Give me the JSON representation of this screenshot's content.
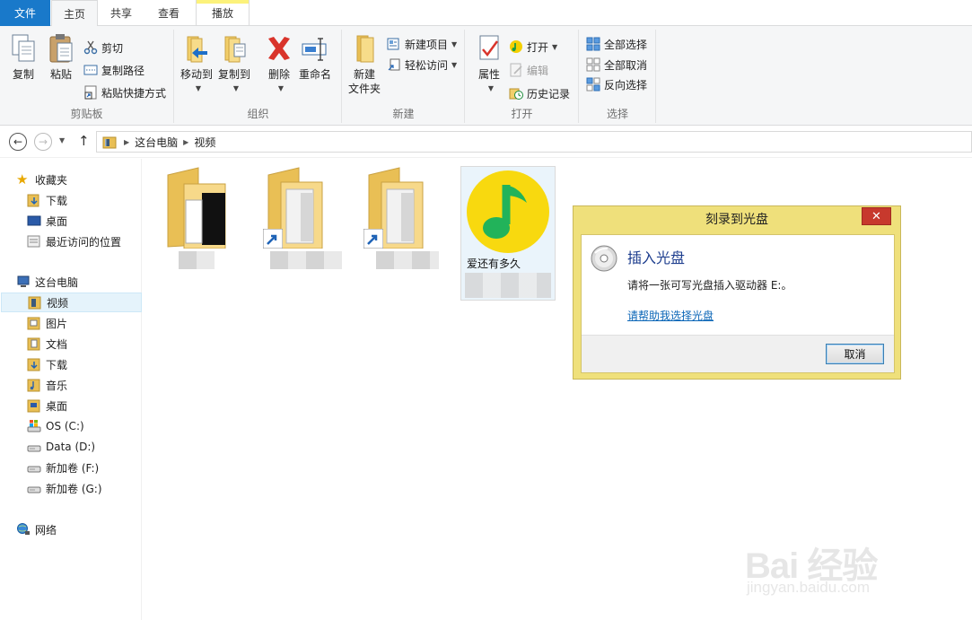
{
  "tabs": {
    "file": "文件",
    "home": "主页",
    "share": "共享",
    "view": "查看",
    "play": "播放"
  },
  "ribbon": {
    "clipboard": {
      "label": "剪贴板",
      "copy": "复制",
      "paste": "粘贴",
      "cut": "剪切",
      "copy_path": "复制路径",
      "paste_shortcut": "粘贴快捷方式"
    },
    "organize": {
      "label": "组织",
      "move_to": "移动到",
      "copy_to": "复制到",
      "delete": "删除",
      "rename": "重命名"
    },
    "new": {
      "label": "新建",
      "new_folder_line1": "新建",
      "new_folder_line2": "文件夹",
      "new_item": "新建项目",
      "easy_access": "轻松访问"
    },
    "open": {
      "label": "打开",
      "properties": "属性",
      "open": "打开",
      "edit": "编辑",
      "history": "历史记录"
    },
    "select": {
      "label": "选择",
      "select_all": "全部选择",
      "select_none": "全部取消",
      "invert": "反向选择"
    }
  },
  "address": {
    "crumbs": [
      "这台电脑",
      "视频"
    ]
  },
  "navpane": {
    "favorites": "收藏夹",
    "downloads": "下载",
    "desktop": "桌面",
    "recent": "最近访问的位置",
    "this_pc": "这台电脑",
    "videos": "视频",
    "pictures": "图片",
    "documents": "文档",
    "downloads2": "下载",
    "music": "音乐",
    "desktop2": "桌面",
    "drive_c": "OS (C:)",
    "drive_d": "Data (D:)",
    "drive_f": "新加卷 (F:)",
    "drive_g": "新加卷 (G:)",
    "network": "网络"
  },
  "files": {
    "music_file": "爱还有多久"
  },
  "dialog": {
    "title": "刻录到光盘",
    "close": "✕",
    "heading": "插入光盘",
    "message": "请将一张可写光盘插入驱动器 E:。",
    "link": "请帮助我选择光盘",
    "cancel": "取消"
  },
  "watermark": {
    "brand": "Bai 经验",
    "url": "jingyan.baidu.com"
  },
  "colors": {
    "file_tab": "#1979ca",
    "dialog_frame": "#efe07b",
    "close_button": "#c7392d",
    "link": "#0b66b7"
  }
}
